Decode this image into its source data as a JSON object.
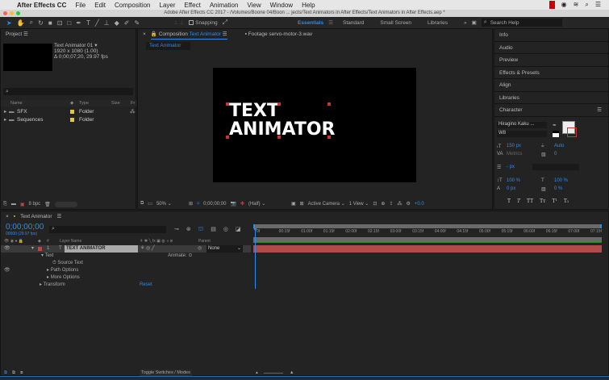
{
  "menu": {
    "app": "After Effects CC",
    "items": [
      "File",
      "Edit",
      "Composition",
      "Layer",
      "Effect",
      "Animation",
      "View",
      "Window",
      "Help"
    ]
  },
  "window_title": "Adobe After Effects CC 2017 - /Volumes/Boone 04/Boon ... jects/Text Animators in After Effects/Text Animators in After Effects.aep *",
  "toolbar": {
    "snapping": "Snapping",
    "workspaces": [
      "Essentials",
      "Standard",
      "Small Screen",
      "Libraries"
    ],
    "search_placeholder": "Search Help"
  },
  "project": {
    "title": "Project",
    "comp_name": "Text Animator 01 ▾",
    "comp_size": "1920 x 1080 (1.00)",
    "comp_duration": "Δ 0;00;07;20, 29.97 fps",
    "columns": [
      "Name",
      "Type",
      "Size",
      "Fr"
    ],
    "items": [
      {
        "name": "SFX",
        "type": "Folder"
      },
      {
        "name": "Sequences",
        "type": "Folder"
      }
    ],
    "bpc": "8 bpc"
  },
  "composition": {
    "tab_label": "Composition",
    "tab_name": "Text Animator",
    "footage_tab": "Footage servo-motor-3.wav",
    "sub_tab": "Text Animator",
    "canvas_text_line1": "TEXT",
    "canvas_text_line2": "ANIMATOR",
    "zoom": "50%",
    "timecode": "0;00;00;00",
    "resolution": "(Half)",
    "camera": "Active Camera",
    "views": "1 View",
    "exposure": "+0.0"
  },
  "right_panels": [
    "Info",
    "Audio",
    "Preview",
    "Effects & Presets",
    "Align",
    "Libraries"
  ],
  "character": {
    "title": "Character",
    "font": "Hiragino Kaku ...",
    "style": "W8",
    "size": "150 px",
    "leading": "Auto",
    "kerning": "Metrics",
    "tracking": "0",
    "stroke": "- px",
    "vscale": "100 %",
    "hscale": "100 %",
    "baseline": "0 px",
    "tsume": "0 %",
    "style_buttons": [
      "T",
      "T",
      "TT",
      "Tт",
      "T¹",
      "T₁"
    ]
  },
  "timeline": {
    "title": "Text Animator",
    "timecode": "0;00;00;00",
    "fps": "00000 (29.97 fps)",
    "col_layer": "Layer Name",
    "col_parent": "Parent",
    "layer_num": "1",
    "layer_name": "TEXT ANIMATOR",
    "parent": "None",
    "text_group": "Text",
    "animate": "Animate:",
    "source_text": "Source Text",
    "path_options": "Path Options",
    "more_options": "More Options",
    "transform": "Transform",
    "reset": "Reset",
    "ruler": [
      "0f",
      "00:15f",
      "01:00f",
      "01:15f",
      "02:00f",
      "02:15f",
      "03:00f",
      "03:15f",
      "04:00f",
      "04:15f",
      "05:00f",
      "05:15f",
      "06:00f",
      "06:15f",
      "07:00f",
      "07:15f"
    ],
    "toggle": "Toggle Switches / Modes"
  },
  "colors": {
    "accent": "#2d8ceb",
    "layer_bar": "#b34a4a",
    "label_red": "#d23c3c",
    "folder_yellow": "#e6c832"
  }
}
